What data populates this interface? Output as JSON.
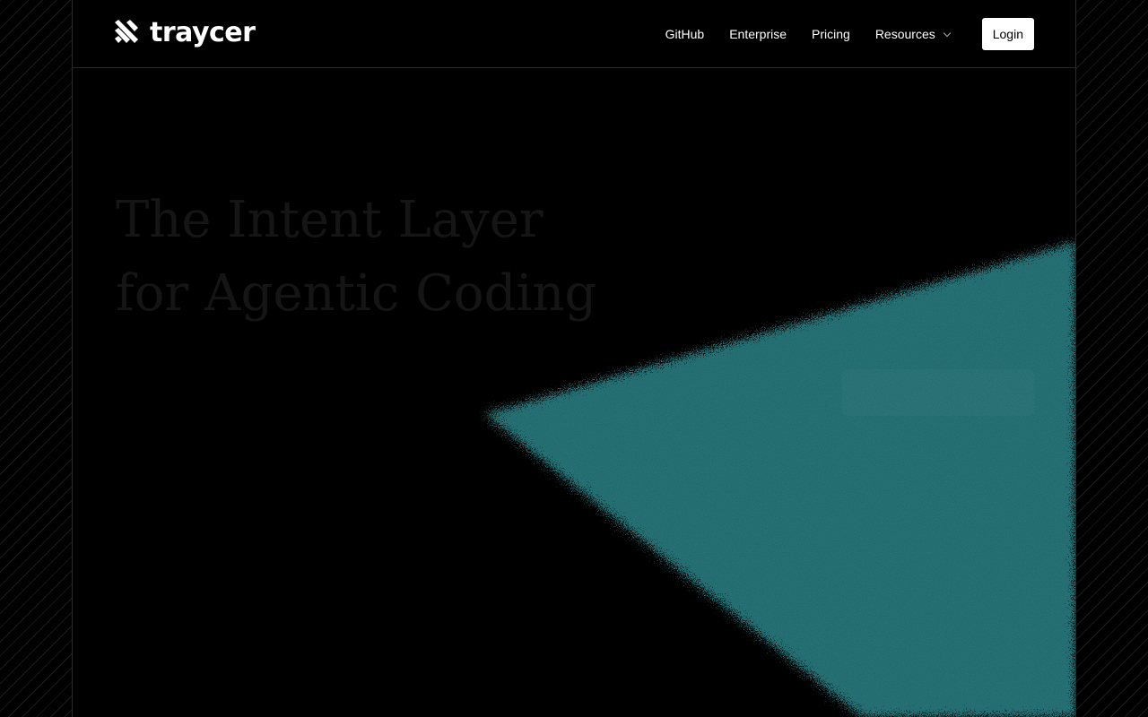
{
  "brand": {
    "name": "traycer",
    "accent_color": "#267276"
  },
  "nav": {
    "links": [
      {
        "label": "GitHub"
      },
      {
        "label": "Enterprise"
      },
      {
        "label": "Pricing"
      },
      {
        "label": "Resources"
      }
    ],
    "login_label": "Login"
  },
  "hero": {
    "title_line_1": "The Intent Layer",
    "title_line_2": "for Agentic Coding"
  }
}
